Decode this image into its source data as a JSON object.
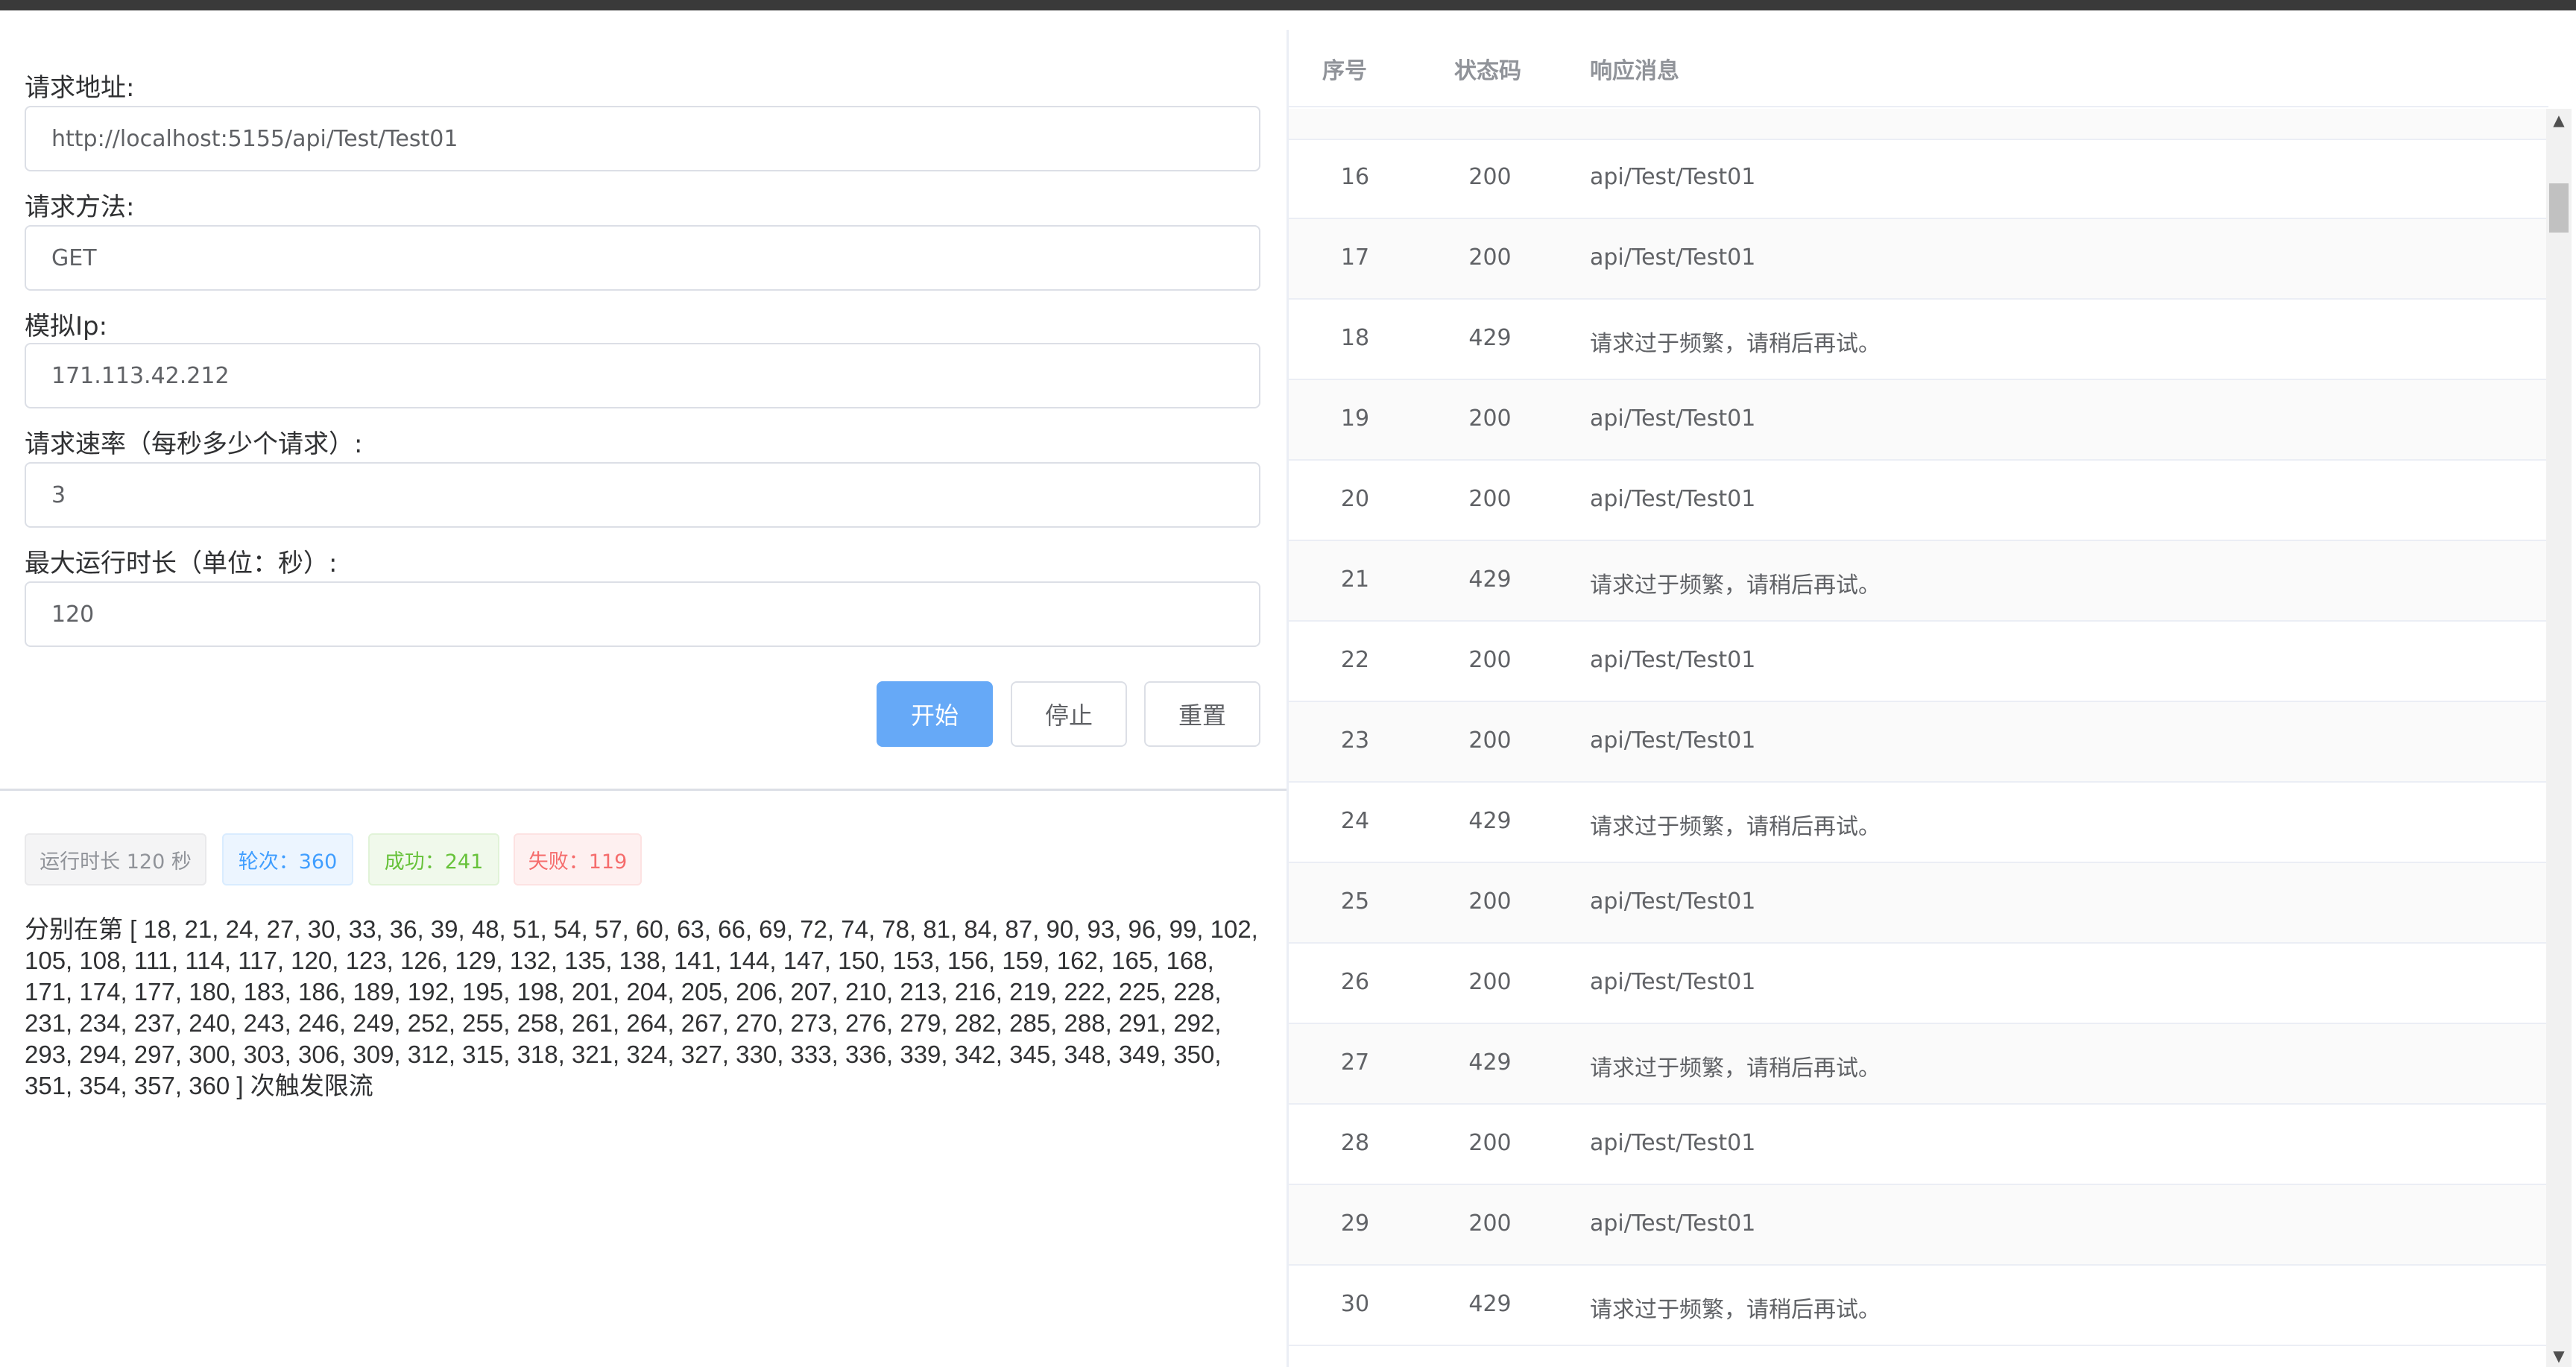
{
  "form": {
    "url_label": "请求地址:",
    "url_value": "http://localhost:5155/api/Test/Test01",
    "method_label": "请求方法:",
    "method_value": "GET",
    "ip_label": "模拟Ip:",
    "ip_value": "171.113.42.212",
    "rate_label": "请求速率（每秒多少个请求）:",
    "rate_value": "3",
    "duration_label": "最大运行时长（单位：秒）:",
    "duration_value": "120"
  },
  "buttons": {
    "start": "开始",
    "stop": "停止",
    "reset": "重置"
  },
  "stats": {
    "runtime": "运行时长 120 秒",
    "rounds": "轮次：360",
    "success": "成功：241",
    "fail": "失败：119"
  },
  "summary": "分别在第 [ 18, 21, 24, 27, 30, 33, 36, 39, 48, 51, 54, 57, 60, 63, 66, 69, 72, 74, 78, 81, 84, 87, 90, 93, 96, 99, 102, 105, 108, 111, 114, 117, 120, 123, 126, 129, 132, 135, 138, 141, 144, 147, 150, 153, 156, 159, 162, 165, 168, 171, 174, 177, 180, 183, 186, 189, 192, 195, 198, 201, 204, 205, 206, 207, 210, 213, 216, 219, 222, 225, 228, 231, 234, 237, 240, 243, 246, 249, 252, 255, 258, 261, 264, 267, 270, 273, 276, 279, 282, 285, 288, 291, 292, 293, 294, 297, 300, 303, 306, 309, 312, 315, 318, 321, 324, 327, 330, 333, 336, 339, 342, 345, 348, 349, 350, 351, 354, 357, 360 ] 次触发限流",
  "table": {
    "headers": {
      "seq": "序号",
      "code": "状态码",
      "msg": "响应消息"
    },
    "rows": [
      {
        "seq": "16",
        "code": "200",
        "msg": "api/Test/Test01"
      },
      {
        "seq": "17",
        "code": "200",
        "msg": "api/Test/Test01"
      },
      {
        "seq": "18",
        "code": "429",
        "msg": "请求过于频繁，请稍后再试。"
      },
      {
        "seq": "19",
        "code": "200",
        "msg": "api/Test/Test01"
      },
      {
        "seq": "20",
        "code": "200",
        "msg": "api/Test/Test01"
      },
      {
        "seq": "21",
        "code": "429",
        "msg": "请求过于频繁，请稍后再试。"
      },
      {
        "seq": "22",
        "code": "200",
        "msg": "api/Test/Test01"
      },
      {
        "seq": "23",
        "code": "200",
        "msg": "api/Test/Test01"
      },
      {
        "seq": "24",
        "code": "429",
        "msg": "请求过于频繁，请稍后再试。"
      },
      {
        "seq": "25",
        "code": "200",
        "msg": "api/Test/Test01"
      },
      {
        "seq": "26",
        "code": "200",
        "msg": "api/Test/Test01"
      },
      {
        "seq": "27",
        "code": "429",
        "msg": "请求过于频繁，请稍后再试。"
      },
      {
        "seq": "28",
        "code": "200",
        "msg": "api/Test/Test01"
      },
      {
        "seq": "29",
        "code": "200",
        "msg": "api/Test/Test01"
      },
      {
        "seq": "30",
        "code": "429",
        "msg": "请求过于频繁，请稍后再试。"
      }
    ]
  },
  "icons": {
    "scroll_up": "scroll-up-arrow-icon",
    "scroll_down": "scroll-down-arrow-icon"
  },
  "colors": {
    "primary": "#66a9f7",
    "success": "#67c23a",
    "danger": "#f56c6c",
    "info": "#909399"
  }
}
